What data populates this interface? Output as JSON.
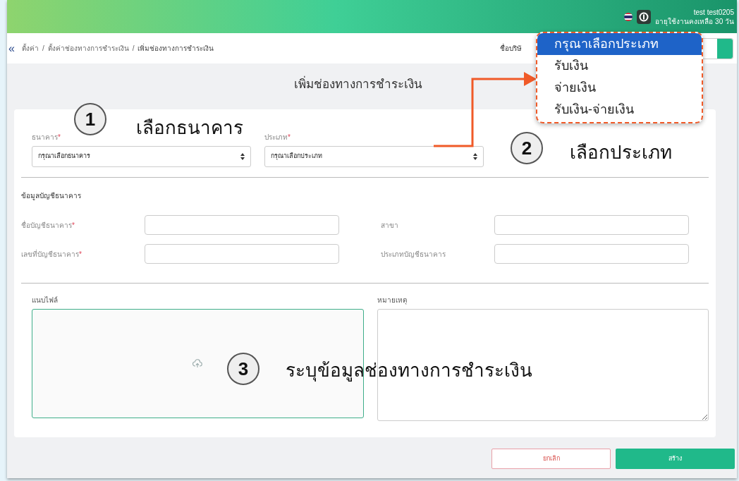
{
  "header": {
    "user_name": "test test0205",
    "subscription": "อายุใช้งานคงเหลือ 30 วัน"
  },
  "breadcrumb": {
    "collapse_symbol": "«",
    "separator": "/",
    "items": [
      "ตั้งค่า",
      "ตั้งค่าช่องทางการชำระเงิน",
      "เพิ่มช่องทางการชำระเงิน"
    ]
  },
  "company_label": "ชื่อบริษั",
  "page_title": "เพิ่มช่องทางการชำระเงิน",
  "form": {
    "required_mark": "*",
    "selects": [
      {
        "label": "ธนาคาร",
        "required": true,
        "value": "กรุณาเลือกธนาคาร"
      },
      {
        "label": "ประเภท",
        "required": true,
        "value": "กรุณาเลือกประเภท"
      }
    ],
    "section_title": "ข้อมูลบัญชีธนาคาร",
    "fields": [
      {
        "label": "ชื่อบัญชีธนาคาร",
        "required": true
      },
      {
        "label": "สาขา",
        "required": false
      },
      {
        "label": "เลขที่บัญชีธนาคาร",
        "required": true
      },
      {
        "label": "ประเภทบัญชีธนาคาร",
        "required": false
      }
    ],
    "attach_label": "แนบไฟล์",
    "note_label": "หมายเหตุ"
  },
  "buttons": [
    {
      "label": "ยกเลิก",
      "kind": "cancel"
    },
    {
      "label": "สร้าง",
      "kind": "primary"
    }
  ],
  "type_dropdown": {
    "options": [
      {
        "label": "กรุณาเลือกประเภท",
        "selected": true
      },
      {
        "label": "รับเงิน",
        "selected": false
      },
      {
        "label": "จ่ายเงิน",
        "selected": false
      },
      {
        "label": "รับเงิน-จ่ายเงิน",
        "selected": false
      }
    ]
  },
  "annotations": [
    {
      "number": "1",
      "text": "เลือกธนาคาร"
    },
    {
      "number": "2",
      "text": "เลือกประเภท"
    },
    {
      "number": "3",
      "text": "ระบุข้อมูลช่องทางการชำระเงิน"
    }
  ]
}
